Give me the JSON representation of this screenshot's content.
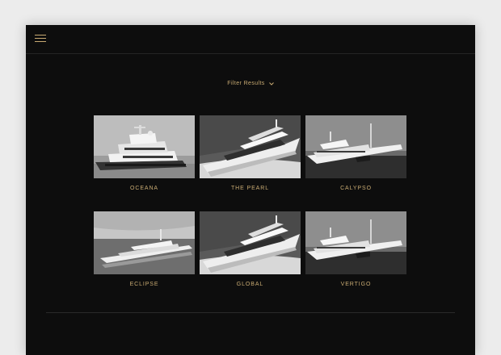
{
  "header": {
    "menu_icon": "hamburger-menu-icon"
  },
  "filter": {
    "label": "Filter Results",
    "icon": "chevron-down-icon"
  },
  "yachts": [
    {
      "name": "OCEANA"
    },
    {
      "name": "THE PEARL"
    },
    {
      "name": "CALYPSO"
    },
    {
      "name": "ECLIPSE"
    },
    {
      "name": "GLOBAL"
    },
    {
      "name": "VERTIGO"
    }
  ],
  "colors": {
    "accent": "#c8aa72",
    "background": "#0d0d0d",
    "page": "#ececec"
  }
}
